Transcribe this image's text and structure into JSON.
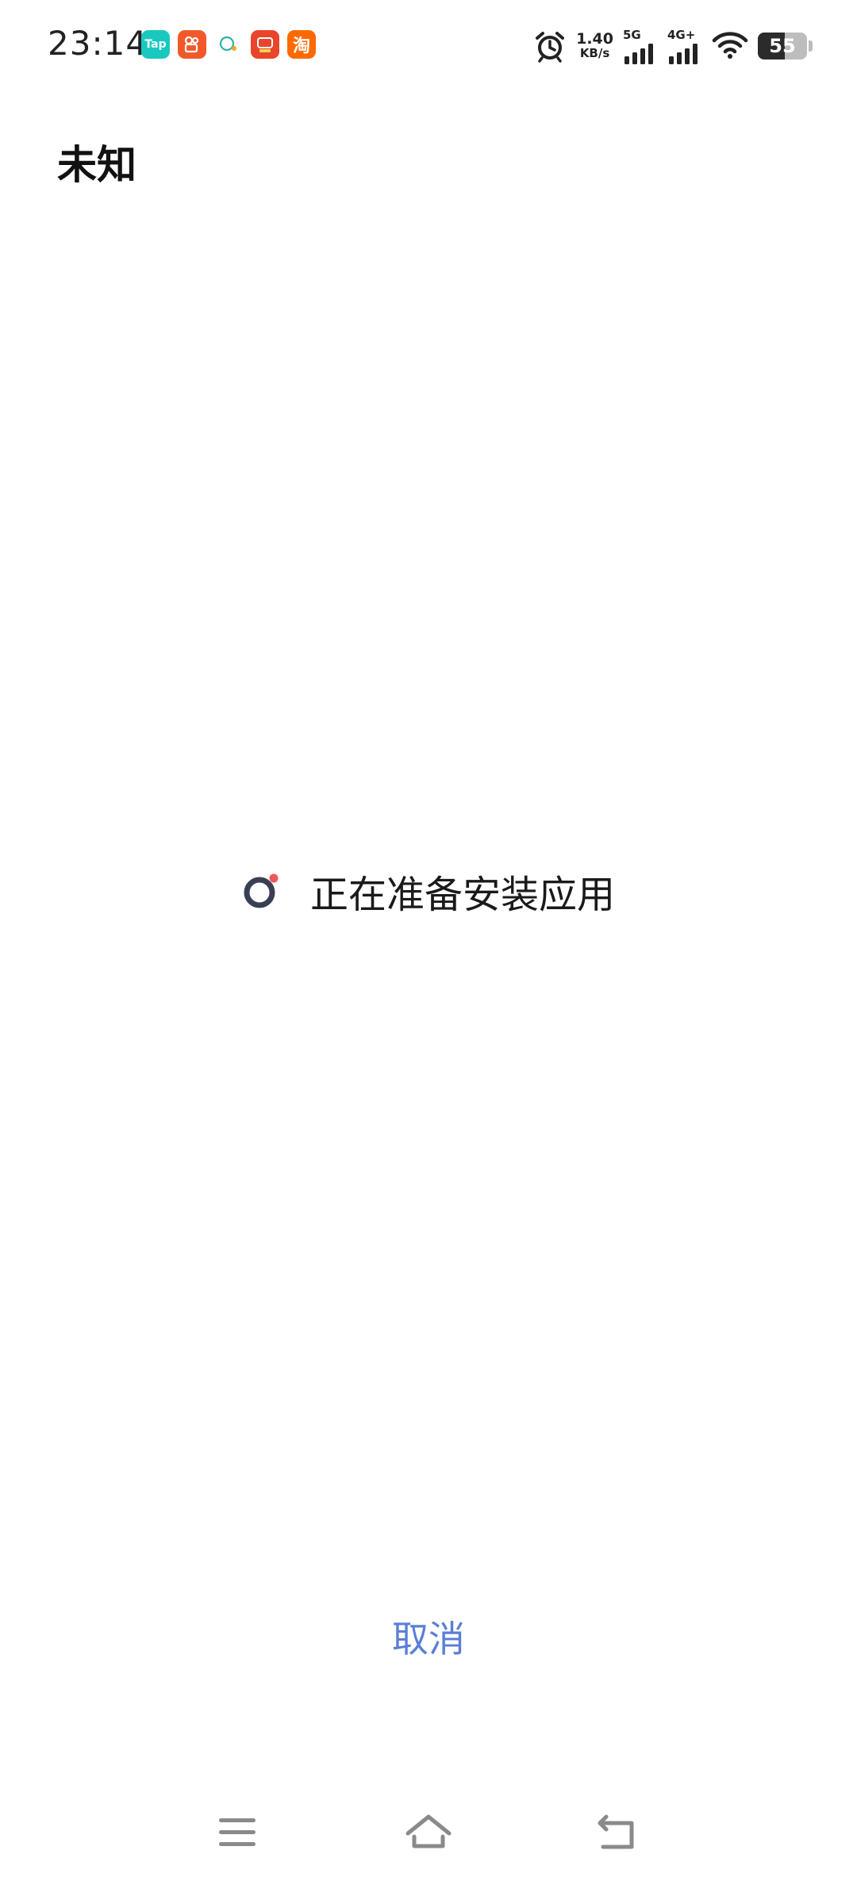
{
  "status_bar": {
    "time": "23:14",
    "notification_apps": [
      {
        "icon": "taptap-icon",
        "label": "Tap",
        "color": "#19c9c0"
      },
      {
        "icon": "kuaishou-icon",
        "label": "",
        "color": "#f1592a"
      },
      {
        "icon": "chat-icon",
        "label": "",
        "color": "#ffffff"
      },
      {
        "icon": "news-app-icon",
        "label": "",
        "color": "#e8452c"
      },
      {
        "icon": "taobao-icon",
        "label": "淘",
        "color": "#ff6a00"
      }
    ],
    "network_speed": "1.40",
    "network_speed_unit": "KB/s",
    "signal1_label": "5G",
    "signal2_label": "4G+",
    "battery_level": "55",
    "icons": [
      "alarm-icon",
      "signal-icon",
      "signal-icon",
      "wifi-icon",
      "battery-icon"
    ]
  },
  "header": {
    "title": "未知"
  },
  "main": {
    "progress_text": "正在准备安装应用",
    "spinner_color": "#3b3f55",
    "spinner_dot_color": "#f2545b"
  },
  "actions": {
    "cancel_label": "取消",
    "accent_color": "#5b7fd6"
  },
  "nav_bar": {
    "icons": [
      "menu-icon",
      "home-icon",
      "back-icon"
    ]
  }
}
